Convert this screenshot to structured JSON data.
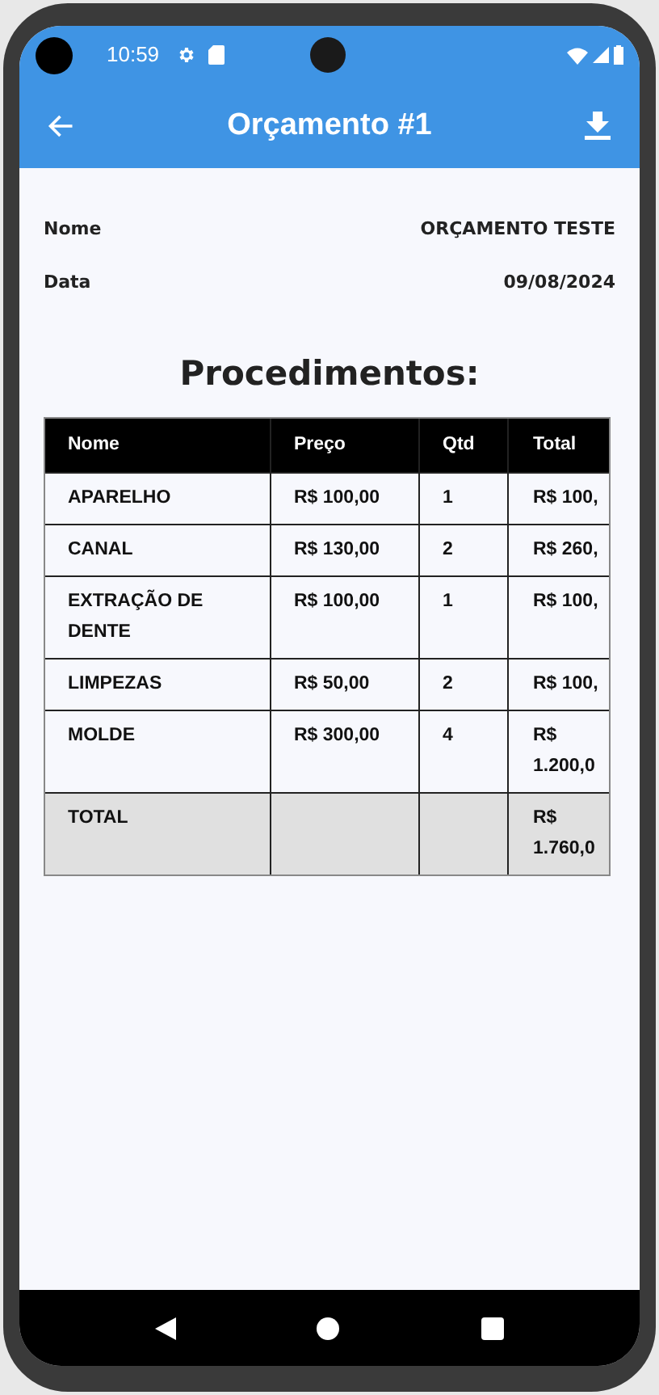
{
  "status_bar": {
    "time": "10:59"
  },
  "app_bar": {
    "title": "Orçamento #1"
  },
  "info": [
    {
      "label": "Nome",
      "value": "ORÇAMENTO TESTE"
    },
    {
      "label": "Data",
      "value": "09/08/2024"
    }
  ],
  "section_title": "Procedimentos:",
  "table": {
    "columns": [
      "Nome",
      "Preço",
      "Qtd",
      "Total"
    ],
    "rows": [
      {
        "kind": "item",
        "cells": [
          "APARELHO",
          "R$ 100,00",
          "1",
          "R$ 100,"
        ]
      },
      {
        "kind": "item",
        "cells": [
          "CANAL",
          "R$ 130,00",
          "2",
          "R$ 260,"
        ]
      },
      {
        "kind": "item",
        "cells": [
          "EXTRAÇÃO DE DENTE",
          "R$ 100,00",
          "1",
          "R$ 100,"
        ]
      },
      {
        "kind": "item",
        "cells": [
          "LIMPEZAS",
          "R$ 50,00",
          "2",
          "R$ 100,"
        ]
      },
      {
        "kind": "item",
        "cells": [
          "MOLDE",
          "R$ 300,00",
          "4",
          "R$ 1.200,0"
        ]
      },
      {
        "kind": "total",
        "cells": [
          "TOTAL",
          "",
          "",
          "R$ 1.760,0"
        ]
      }
    ]
  }
}
